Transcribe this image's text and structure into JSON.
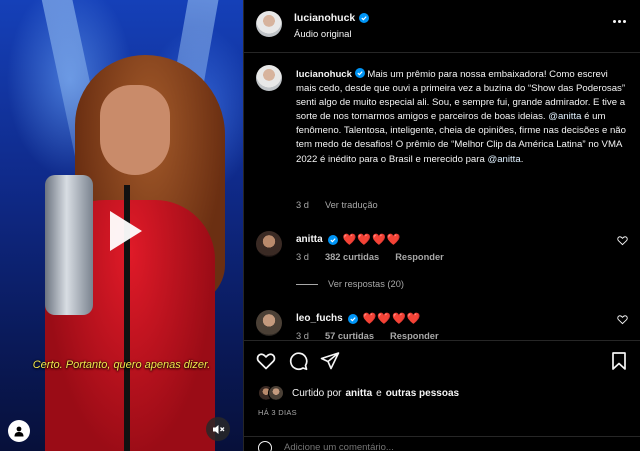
{
  "video": {
    "subtitle": "Certo. Portanto, quero apenas dizer.",
    "play_icon": "play-icon",
    "mute_icon": "speaker-muted-icon",
    "avatar_icon": "user-icon"
  },
  "post": {
    "username": "lucianohuck",
    "audio_label": "Áudio original",
    "more_icon": "more-horizontal-icon",
    "verified_color": "#0095f6"
  },
  "caption": {
    "username": "lucianohuck",
    "part1": "Mais um prêmio para nossa embaixadora! Como escrevi mais cedo, desde que ouvi a primeira vez a buzina do “Show das Poderosas” senti algo de muito especial ali. Sou, e sempre fui, grande admirador. E tive a sorte de nos tornarmos amigos e parceiros de boas ideias. ",
    "mention1": "@anitta",
    "part2": " é um fenômeno. Talentosa, inteligente, cheia de opiniões, firme nas decisões e não tem medo de desafios! O prêmio de “Melhor Clip da América Latina” no VMA 2022 é inédito para o Brasil e merecido para ",
    "mention2": "@anitta",
    "part3": ".",
    "age": "3 d",
    "translate": "Ver tradução"
  },
  "comments": [
    {
      "username": "anitta",
      "text": "❤️❤️❤️❤️",
      "age": "3 d",
      "likes": "382 curtidas",
      "reply": "Responder",
      "view_replies": "Ver respostas (20)"
    },
    {
      "username": "leo_fuchs",
      "text": "❤️❤️❤️❤️",
      "age": "3 d",
      "likes": "57 curtidas",
      "reply": "Responder"
    }
  ],
  "actions": {
    "like_icon": "heart-icon",
    "comment_icon": "comment-icon",
    "share_icon": "send-icon",
    "save_icon": "bookmark-icon",
    "liked_by_prefix": "Curtido por",
    "liked_by_user": "anitta",
    "liked_by_and": "e",
    "liked_by_others": "outras pessoas",
    "timestamp": "HÁ 3 DIAS"
  },
  "add_comment": {
    "placeholder": "Adicione um comentário...",
    "emoji_icon": "emoji-icon"
  }
}
